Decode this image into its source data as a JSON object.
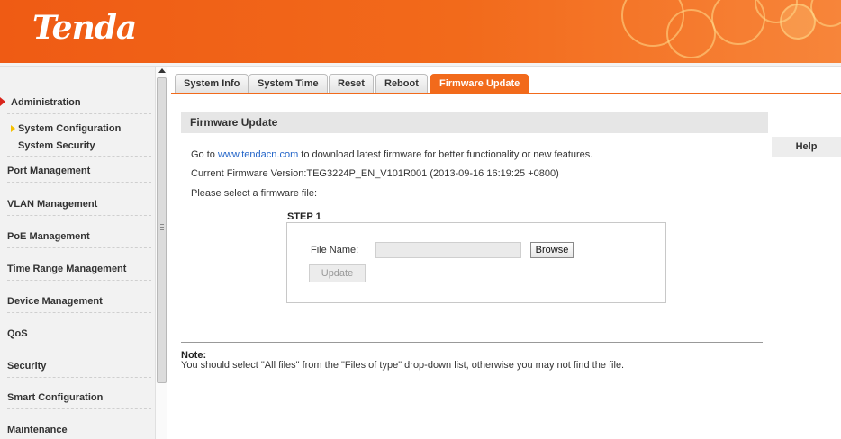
{
  "brand": {
    "logo": "Tenda",
    "accent": "#f26a1b"
  },
  "sidebar": {
    "items": [
      {
        "label": "Administration",
        "expanded": true
      },
      {
        "label": "System Configuration",
        "selected": true
      },
      {
        "label": "System Security"
      },
      {
        "label": "Port Management"
      },
      {
        "label": "VLAN Management"
      },
      {
        "label": "PoE Management"
      },
      {
        "label": "Time Range Management"
      },
      {
        "label": "Device Management"
      },
      {
        "label": "QoS"
      },
      {
        "label": "Security"
      },
      {
        "label": "Smart Configuration"
      },
      {
        "label": "Maintenance"
      }
    ]
  },
  "tabs": [
    {
      "label": "System Info"
    },
    {
      "label": "System Time"
    },
    {
      "label": "Reset"
    },
    {
      "label": "Reboot"
    },
    {
      "label": "Firmware Update",
      "active": true
    }
  ],
  "main": {
    "section_title": "Firmware Update",
    "help_label": "Help",
    "goto_prefix": "Go to ",
    "goto_link": "www.tendacn.com",
    "goto_suffix": " to download latest firmware for better functionality or new features.",
    "current_version": "Current Firmware Version:TEG3224P_EN_V101R001 (2013-09-16 16:19:25 +0800)",
    "select_prompt": "Please select a firmware file:",
    "step_title": "STEP 1",
    "file_name_label": "File Name:",
    "file_name_value": "",
    "browse_label": "Browse",
    "update_label": "Update",
    "note_title": "Note:",
    "note_text": "You should select \"All files\" from the \"Files of type\" drop-down list, otherwise you may not find the file."
  }
}
